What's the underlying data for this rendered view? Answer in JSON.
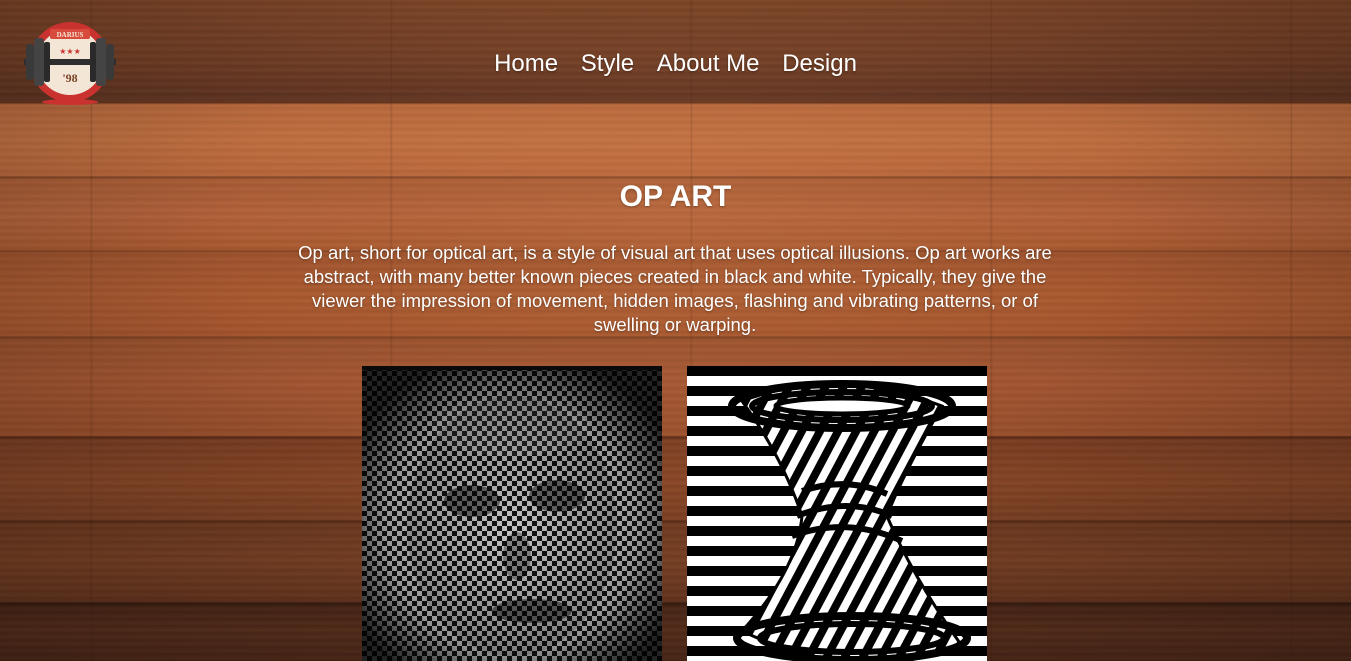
{
  "logo": {
    "icon": "dumbbell-logo-icon",
    "top_text": "DARIUS",
    "bottom_text": "'98",
    "colors": {
      "ring": "#c9322f",
      "plates": "#3a3a3a",
      "badge": "#f3e6d6"
    }
  },
  "nav": {
    "items": [
      {
        "label": "Home"
      },
      {
        "label": "Style"
      },
      {
        "label": "About Me"
      },
      {
        "label": "Design"
      }
    ]
  },
  "main": {
    "title": "OP ART",
    "description": "Op art, short for optical art, is a style of visual art that uses optical illusions. Op art works are abstract, with many better known pieces created in black and white. Typically, they give the viewer the impression of movement, hidden images, flashing and vibrating patterns, or of swelling or warping.",
    "images": [
      {
        "icon": "op-art-face-checker-image"
      },
      {
        "icon": "op-art-striped-vortex-image"
      }
    ]
  },
  "colors": {
    "text": "#ffffff",
    "wood": "#a9592f"
  }
}
